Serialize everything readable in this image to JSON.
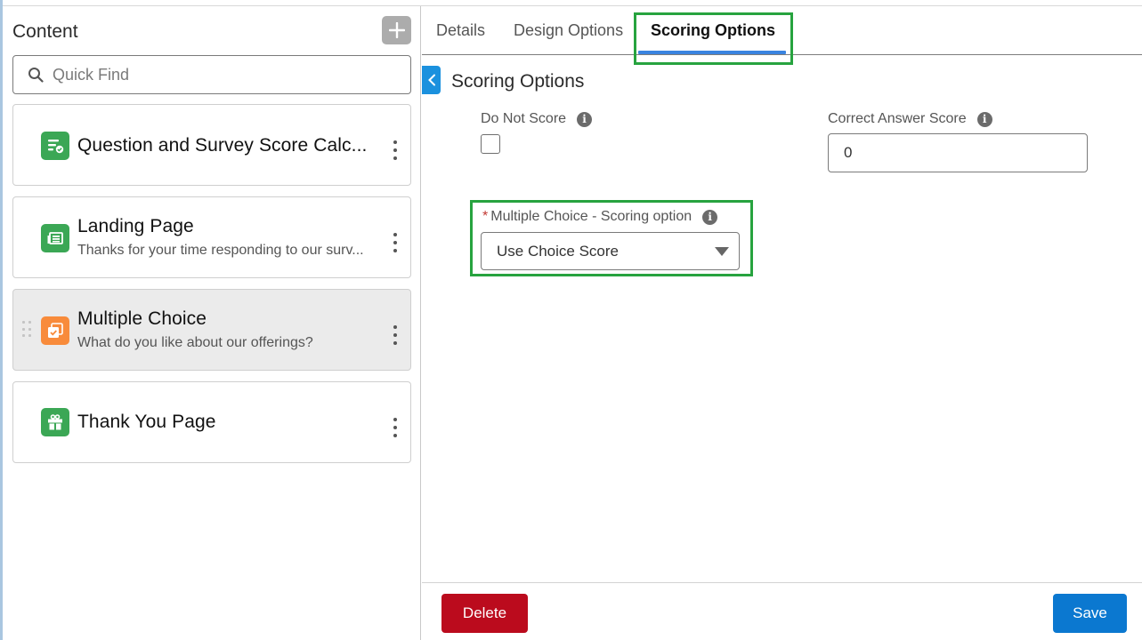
{
  "sidebar": {
    "title": "Content",
    "add_button_icon": "plus-icon",
    "search": {
      "placeholder": "Quick Find",
      "value": "",
      "icon": "search-icon"
    },
    "items": [
      {
        "title": "Question and Survey Score Calc...",
        "subtitle": "",
        "icon": "score-calculation-icon",
        "icon_color": "#3ba755",
        "selected": false
      },
      {
        "title": "Landing Page",
        "subtitle": "Thanks for your time responding to our surv...",
        "icon": "landing-page-icon",
        "icon_color": "#3ba755",
        "selected": false
      },
      {
        "title": "Multiple Choice",
        "subtitle": "What do you like about our offerings?",
        "icon": "multiple-choice-icon",
        "icon_color": "#f88b3b",
        "selected": true
      },
      {
        "title": "Thank You Page",
        "subtitle": "",
        "icon": "gift-icon",
        "icon_color": "#3ba755",
        "selected": false
      }
    ]
  },
  "main": {
    "tabs": [
      {
        "label": "Details",
        "active": false
      },
      {
        "label": "Design Options",
        "active": false
      },
      {
        "label": "Scoring Options",
        "active": true
      }
    ],
    "section_title": "Scoring Options",
    "fields": {
      "do_not_score": {
        "label": "Do Not Score",
        "checked": false
      },
      "correct_answer_score": {
        "label": "Correct Answer Score",
        "value": "0"
      },
      "multiple_choice_scoring": {
        "required_marker": "*",
        "label": "Multiple Choice - Scoring option",
        "selected": "Use Choice Score"
      }
    },
    "info_glyph": "i",
    "footer": {
      "delete_label": "Delete",
      "save_label": "Save"
    }
  },
  "colors": {
    "accent_blue": "#0b78d0",
    "tab_underline": "#3a84e0",
    "delete_red": "#bb0b1d",
    "highlight_green": "#27a33f",
    "required_red": "#c23934"
  }
}
